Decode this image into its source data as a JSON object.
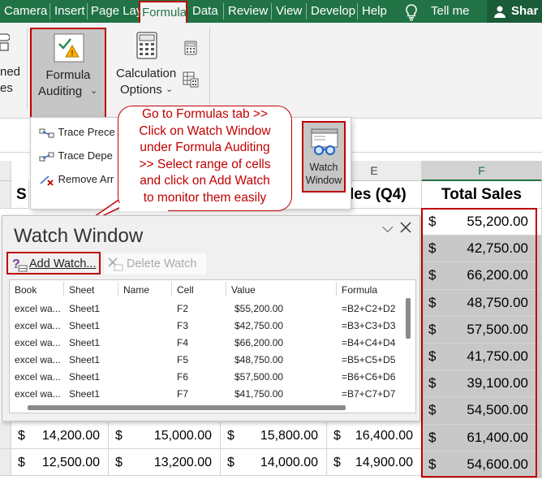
{
  "ribbon_tabs": [
    "Camera",
    "Insert",
    "Page Lay",
    "Formula",
    "Data",
    "Review",
    "View",
    "Develop",
    "Help",
    "Tell me",
    "Shar"
  ],
  "ribbon": {
    "defined_names_partial": [
      "ned",
      "es"
    ],
    "formula_auditing": [
      "Formula",
      "Auditing"
    ],
    "calculation_options": [
      "Calculation",
      "Options"
    ]
  },
  "menu": {
    "items": [
      "Trace Prece",
      "Trace Depe",
      "Remove Arr"
    ],
    "watch_window": [
      "Watch",
      "Window"
    ]
  },
  "callout_lines": [
    "Go to Formulas tab >>",
    "Click on Watch Window",
    "under Formula Auditing",
    ">> Select range of cells",
    "and click on Add Watch",
    "to monitor them easily"
  ],
  "grid": {
    "col_e": "E",
    "col_f": "F",
    "header_s": "S",
    "header_e": "les (Q4)",
    "header_f": "Total Sales",
    "currency": "$",
    "total_sales": [
      "55,200.00",
      "42,750.00",
      "66,200.00",
      "48,750.00",
      "57,500.00",
      "41,750.00",
      "39,100.00",
      "54,500.00",
      "61,400.00",
      "54,600.00"
    ],
    "bottom_rows": [
      [
        "14,200.00",
        "15,000.00",
        "15,800.00",
        "16,400.00"
      ],
      [
        "12,500.00",
        "13,200.00",
        "14,000.00",
        "14,900.00"
      ]
    ]
  },
  "watch_window": {
    "title": "Watch Window",
    "add_watch": "Add Watch...",
    "delete_watch": "Delete Watch",
    "columns": [
      "Book",
      "Sheet",
      "Name",
      "Cell",
      "Value",
      "Formula"
    ],
    "rows": [
      [
        "excel wa...",
        "Sheet1",
        "",
        "F2",
        "$55,200.00",
        "=B2+C2+D2"
      ],
      [
        "excel wa...",
        "Sheet1",
        "",
        "F3",
        "$42,750.00",
        "=B3+C3+D3"
      ],
      [
        "excel wa...",
        "Sheet1",
        "",
        "F4",
        "$66,200.00",
        "=B4+C4+D4"
      ],
      [
        "excel wa...",
        "Sheet1",
        "",
        "F5",
        "$48,750.00",
        "=B5+C5+D5"
      ],
      [
        "excel wa...",
        "Sheet1",
        "",
        "F6",
        "$57,500.00",
        "=B6+C6+D6"
      ],
      [
        "excel wa...",
        "Sheet1",
        "",
        "F7",
        "$41,750.00",
        "=B7+C7+D7"
      ]
    ]
  }
}
